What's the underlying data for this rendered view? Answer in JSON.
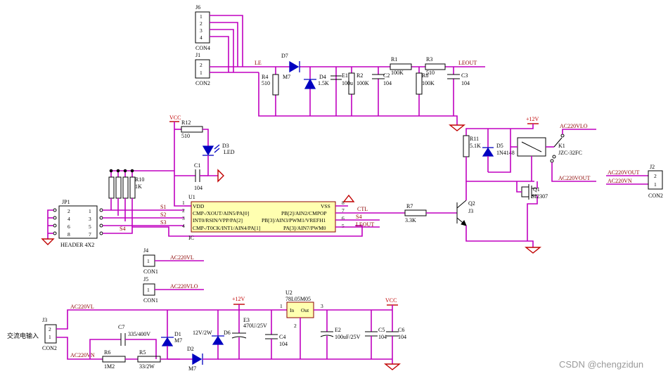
{
  "connectors": {
    "j6": {
      "ref": "J6",
      "type": "CON4",
      "pins": [
        "1",
        "2",
        "3",
        "4"
      ]
    },
    "j1": {
      "ref": "J1",
      "type": "CON2",
      "pins": [
        "2",
        "1"
      ]
    },
    "jp1": {
      "ref": "JP1",
      "type": "HEADER 4X2",
      "pins_left": [
        "2",
        "4",
        "6",
        "8"
      ],
      "pins_right": [
        "1",
        "3",
        "5",
        "7"
      ]
    },
    "j4": {
      "ref": "J4",
      "type": "CON1",
      "pin": "1"
    },
    "j5": {
      "ref": "J5",
      "type": "CON1",
      "pin": "1"
    },
    "j3": {
      "ref": "J3",
      "type": "CON2",
      "pins": [
        "2",
        "1"
      ]
    },
    "j2": {
      "ref": "J2",
      "type": "CON2",
      "pins": [
        "2",
        "1"
      ]
    }
  },
  "nets": {
    "le": "LE",
    "leout": "LEOUT",
    "vcc": "VCC",
    "plus12v": "+12V",
    "ac220vl": "AC220VL",
    "ac220vlo": "AC220VLO",
    "ac220vout": "AC220VOUT",
    "ac220vn": "AC220VN",
    "s1": "S1",
    "s2": "S2",
    "s3": "S3",
    "s4": "S4",
    "ctl": "CTL"
  },
  "components": {
    "d7": {
      "ref": "D7",
      "value": "M7"
    },
    "r4": {
      "ref": "R4",
      "value": "510"
    },
    "d4": {
      "ref": "D4",
      "value": "1.5K"
    },
    "e1": {
      "ref": "E1",
      "value": "100u"
    },
    "r2": {
      "ref": "R2",
      "value": "100K"
    },
    "c2": {
      "ref": "C2",
      "value": "104"
    },
    "r1": {
      "ref": "R1",
      "value": "100K"
    },
    "r3": {
      "ref": "R3",
      "value": "510"
    },
    "r8": {
      "ref": "R8",
      "value": "100K"
    },
    "c3": {
      "ref": "C3",
      "value": "104"
    },
    "r12": {
      "ref": "R12",
      "value": "510"
    },
    "d3": {
      "ref": "D3",
      "value": "LED"
    },
    "c1": {
      "ref": "C1",
      "value": "104"
    },
    "r_array": {
      "ref": "R10",
      "value": "1K"
    },
    "r7": {
      "ref": "R7",
      "value": "3.3K"
    },
    "q2": {
      "ref": "Q2",
      "value": "J3"
    },
    "r11": {
      "ref": "R11",
      "value": "5.1K"
    },
    "d5": {
      "ref": "D5",
      "value": "1N4148"
    },
    "k1": {
      "ref": "K1",
      "value": "JZC-32FC"
    },
    "q1": {
      "ref": "Q1",
      "value": "SI2307"
    },
    "c7": {
      "ref": "C7",
      "value": "335/400V"
    },
    "r6": {
      "ref": "R6",
      "value": "1M2"
    },
    "r5": {
      "ref": "R5",
      "value": "33/2W"
    },
    "d1": {
      "ref": "D1",
      "value": "M7"
    },
    "d2": {
      "ref": "D2",
      "value": "M7"
    },
    "d6": {
      "ref": "D6",
      "value": "12V/2W"
    },
    "e3": {
      "ref": "E3",
      "value": "470U/25V"
    },
    "c4": {
      "ref": "C4",
      "value": "104"
    },
    "u2": {
      "ref": "U2",
      "value": "78L05M05",
      "pin_in": "In",
      "pin_out": "Out",
      "pins": [
        "1",
        "2",
        "3"
      ]
    },
    "e2": {
      "ref": "E2",
      "value": "100uF/25V"
    },
    "c5": {
      "ref": "C5",
      "value": "104"
    },
    "c6": {
      "ref": "C6",
      "value": "104"
    }
  },
  "ic": {
    "ref": "U1",
    "type": "IC",
    "left_pins": [
      {
        "num": "1",
        "name": "VDD"
      },
      {
        "num": "2",
        "name": "CMP-/XOUT/AIN5/PA[0]"
      },
      {
        "num": "3",
        "name": "INT0/RSIN/VPP/PA[2]"
      },
      {
        "num": "4",
        "name": "CMP-/T0CK/INT1/AIN4/PA[1]"
      }
    ],
    "right_pins": [
      {
        "num": "8",
        "name": "VSS"
      },
      {
        "num": "7",
        "name": "PB[2]/AIN2/CMPOP"
      },
      {
        "num": "6",
        "name": "PB[3]/AIN3/PWM1/VREFH1"
      },
      {
        "num": "5",
        "name": "PA[3]/AIN7/PWM0"
      }
    ]
  },
  "ac_input_label": "交流电输入",
  "watermark": "CSDN @chengzidun",
  "colors": {
    "wire": "#c000c0",
    "symbol": "#0000c0",
    "power": "#c00000",
    "ic_fill": "#ffffb0"
  }
}
